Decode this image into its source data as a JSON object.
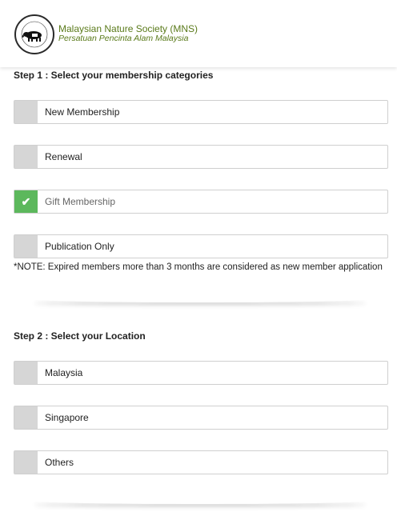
{
  "header": {
    "org_name": "Malaysian Nature Society (MNS)",
    "org_subtitle": "Persatuan Pencinta Alam Malaysia",
    "logo_icon": "tapir-logo-icon",
    "logo_ring_text": "PERSATUAN PENCINTA ALAM MALAYSIA · MALAYSIAN NATURE SOCIETY"
  },
  "step1": {
    "title": "Step 1 : Select your membership categories",
    "options": [
      {
        "label": "New Membership",
        "checked": false
      },
      {
        "label": "Renewal",
        "checked": false
      },
      {
        "label": "Gift Membership",
        "checked": true
      },
      {
        "label": "Publication Only",
        "checked": false
      }
    ],
    "note": "*NOTE: Expired members more than 3 months are considered as new member application"
  },
  "step2": {
    "title": "Step 2 : Select your Location",
    "options": [
      {
        "label": "Malaysia",
        "checked": false
      },
      {
        "label": "Singapore",
        "checked": false
      },
      {
        "label": "Others",
        "checked": false
      }
    ]
  },
  "colors": {
    "checked": "#5cb85c",
    "unchecked_box": "#d6d6d6",
    "brand_text": "#5a7a1a"
  },
  "icons": {
    "check": "✔"
  }
}
